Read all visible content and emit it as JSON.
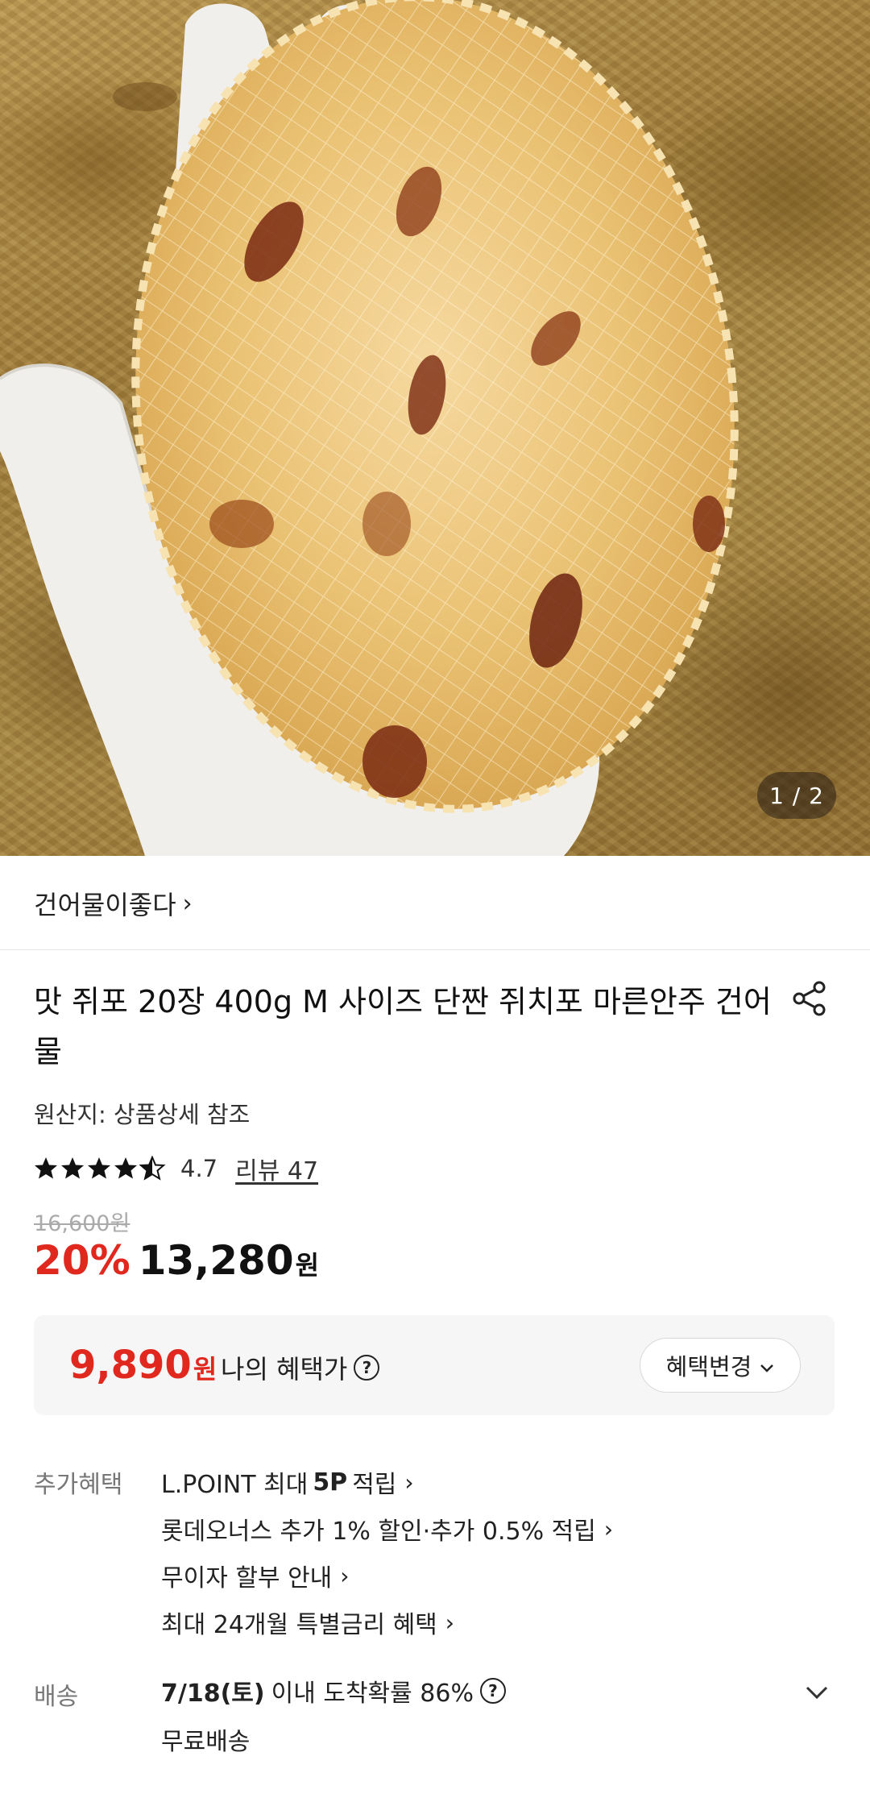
{
  "hero": {
    "counter": "1 / 2"
  },
  "store": {
    "name": "건어물이좋다",
    "chevron": "›"
  },
  "product": {
    "title": "맛 쥐포 20장 400g M 사이즈 단짠 쥐치포 마른안주 건어물",
    "origin": "원산지: 상품상세 참조",
    "rating": "4.7",
    "rating_fraction": 0.94,
    "review_link": "리뷰 47",
    "original_price": "16,600원",
    "discount": "20%",
    "sale_price": "13,280",
    "sale_unit": "원"
  },
  "benefit": {
    "price": "9,890",
    "unit": "원",
    "label": "나의 혜택가",
    "change_button": "혜택변경",
    "help_glyph": "?"
  },
  "extra_benefits": {
    "label": "추가혜택",
    "items": [
      {
        "pre": "L.POINT 최대",
        "bold": "5P",
        "post": "적립"
      },
      {
        "pre": "롯데오너스 추가 1% 할인·추가 0.5% 적립",
        "bold": "",
        "post": ""
      },
      {
        "pre": "무이자 할부 안내",
        "bold": "",
        "post": ""
      },
      {
        "pre": "최대 24개월 특별금리 혜택",
        "bold": "",
        "post": ""
      }
    ],
    "chevron": "›"
  },
  "shipping": {
    "label": "배송",
    "date": "7/18(토)",
    "text": "이내 도착확률 86%",
    "help_glyph": "?",
    "fee": "무료배송"
  },
  "icons": {
    "share": "share-icon",
    "star": "star-icon",
    "chevron_down": "chevron-down-icon",
    "help": "question-circle-icon"
  },
  "colors": {
    "accent_red": "#e0281e",
    "benefit_bg": "#f6f6f6"
  }
}
